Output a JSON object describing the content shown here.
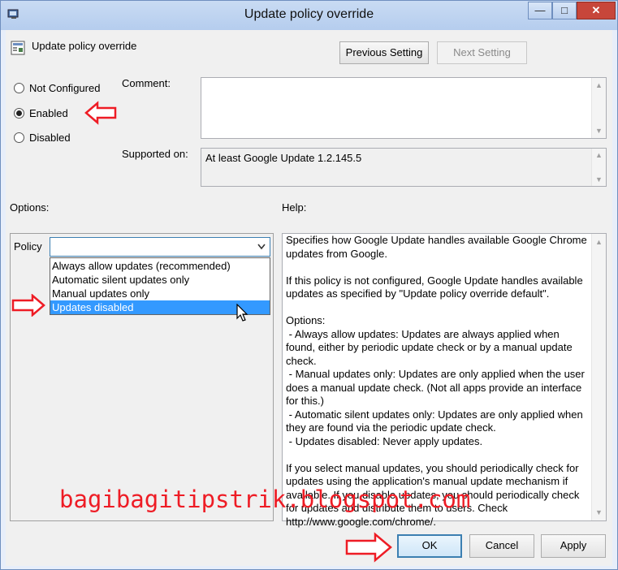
{
  "window": {
    "title": "Update policy override",
    "icons": {
      "app": "policy-icon",
      "minimize": "minimize-icon",
      "maximize": "maximize-icon",
      "close": "close-icon"
    },
    "minimize_glyph": "—",
    "maximize_glyph": "□",
    "close_glyph": "✕"
  },
  "header": {
    "policy_title": "Update policy override",
    "previous_setting": "Previous Setting",
    "next_setting": "Next Setting"
  },
  "state": {
    "options": [
      "Not Configured",
      "Enabled",
      "Disabled"
    ],
    "selected": "Enabled"
  },
  "comment": {
    "label": "Comment:",
    "value": ""
  },
  "supported": {
    "label": "Supported on:",
    "value": "At least Google Update 1.2.145.5"
  },
  "options_panel": {
    "label": "Options:",
    "policy_label": "Policy",
    "dropdown_items": [
      "Always allow updates (recommended)",
      "Automatic silent updates only",
      "Manual updates only",
      "Updates disabled"
    ],
    "highlighted_item": "Updates disabled"
  },
  "help": {
    "label": "Help:",
    "text": "Specifies how Google Update handles available Google Chrome updates from Google.\n\nIf this policy is not configured, Google Update handles available updates as specified by \"Update policy override default\".\n\nOptions:\n - Always allow updates: Updates are always applied when found, either by periodic update check or by a manual update check.\n - Manual updates only: Updates are only applied when the user does a manual update check. (Not all apps provide an interface for this.)\n - Automatic silent updates only: Updates are only applied when they are found via the periodic update check.\n - Updates disabled: Never apply updates.\n\nIf you select manual updates, you should periodically check for updates using the application's manual update mechanism if available. If you disable updates, you should periodically check for updates and distribute them to users. Check http://www.google.com/chrome/."
  },
  "footer": {
    "ok": "OK",
    "cancel": "Cancel",
    "apply": "Apply"
  },
  "watermark": "bagibagitipstrik.blogspot.com",
  "annotation_color": "#ee1c25"
}
